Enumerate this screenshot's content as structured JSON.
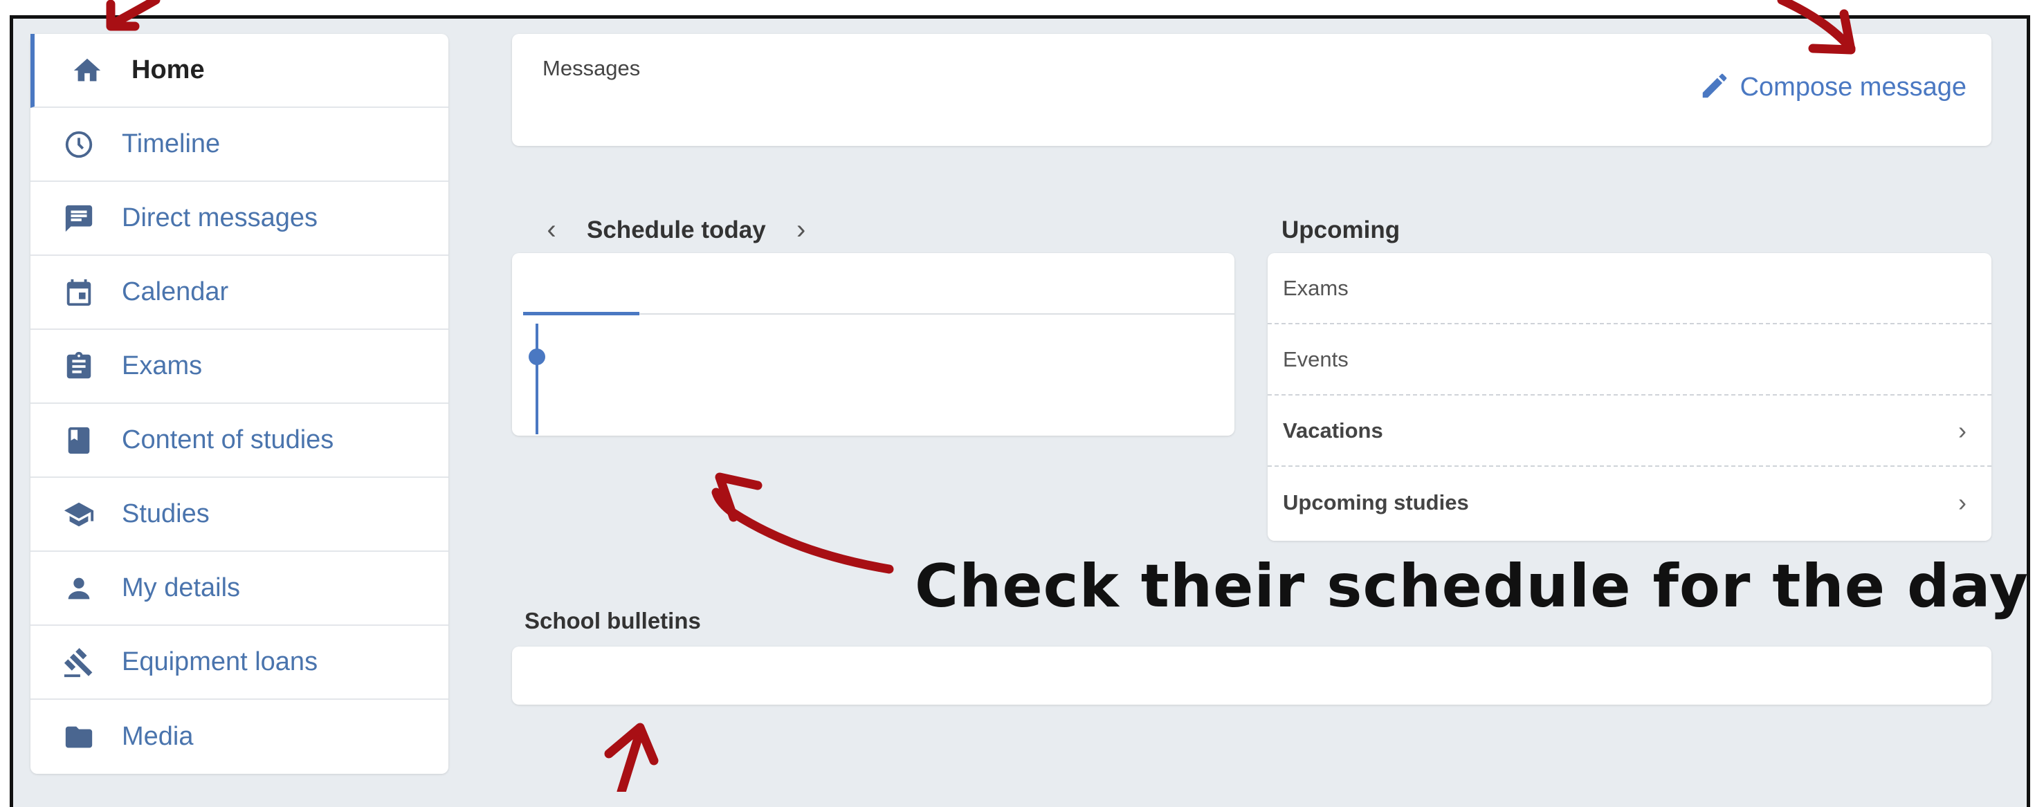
{
  "sidebar": {
    "items": [
      {
        "label": "Home",
        "icon": "home-icon"
      },
      {
        "label": "Timeline",
        "icon": "clock-icon"
      },
      {
        "label": "Direct messages",
        "icon": "chat-icon"
      },
      {
        "label": "Calendar",
        "icon": "calendar-icon"
      },
      {
        "label": "Exams",
        "icon": "clipboard-icon"
      },
      {
        "label": "Content of studies",
        "icon": "book-icon"
      },
      {
        "label": "Studies",
        "icon": "graduation-cap-icon"
      },
      {
        "label": "My details",
        "icon": "person-icon"
      },
      {
        "label": "Equipment loans",
        "icon": "gavel-icon"
      },
      {
        "label": "Media",
        "icon": "folder-icon"
      }
    ]
  },
  "messages": {
    "title": "Messages",
    "compose_label": "Compose message"
  },
  "schedule": {
    "title": "Schedule today"
  },
  "upcoming": {
    "title": "Upcoming",
    "rows": [
      {
        "label": "Exams"
      },
      {
        "label": "Events"
      },
      {
        "label": "Vacations"
      },
      {
        "label": "Upcoming studies"
      }
    ]
  },
  "bulletins": {
    "title": "School bulletins"
  },
  "annotation": {
    "text": "Check their schedule for the day"
  },
  "colors": {
    "accent": "#4a78c2",
    "background": "#e8ecf0",
    "annotation_arrow": "#a80f14"
  }
}
